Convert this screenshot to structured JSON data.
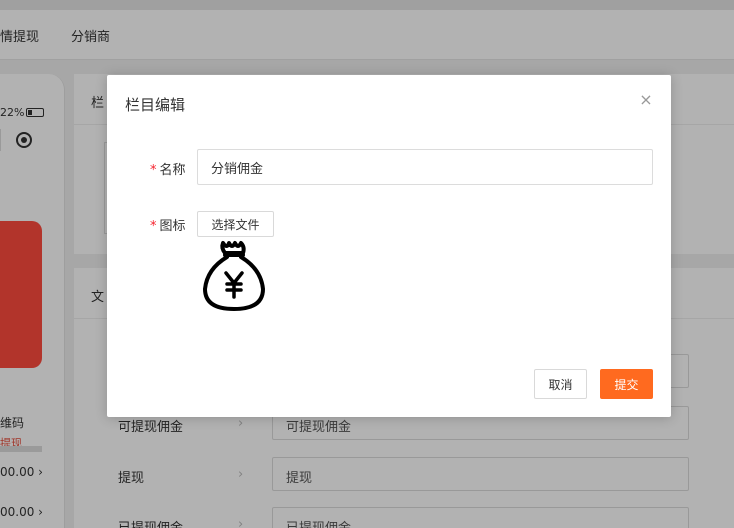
{
  "nav": {
    "tabs": [
      {
        "label": "情提现"
      },
      {
        "label": "分销商"
      }
    ]
  },
  "phone": {
    "battery_text": "22%",
    "red_card_link": "提现",
    "invite_text": "维码",
    "amounts": [
      "00.00",
      "00.00"
    ]
  },
  "panels": {
    "top_title": "栏",
    "bottom_title": "文"
  },
  "rows": [
    {
      "label": "可提现佣金",
      "value": "可提现佣金"
    },
    {
      "label": "提现",
      "value": "提现"
    },
    {
      "label": "已提现佣金",
      "value": "已提现佣金"
    }
  ],
  "modal": {
    "title": "栏目编辑",
    "close_glyph": "×",
    "name_label": "名称",
    "name_value": "分销佣金",
    "icon_label": "图标",
    "required_mark": "*",
    "file_button": "选择文件",
    "icon_image": "money-bag-yen-icon",
    "cancel_label": "取消",
    "submit_label": "提交"
  },
  "colors": {
    "accent": "#ff6a1f",
    "required": "#f5222d",
    "phone_red": "#ff4b3e",
    "overlay": "rgba(0,0,0,0.3)"
  }
}
